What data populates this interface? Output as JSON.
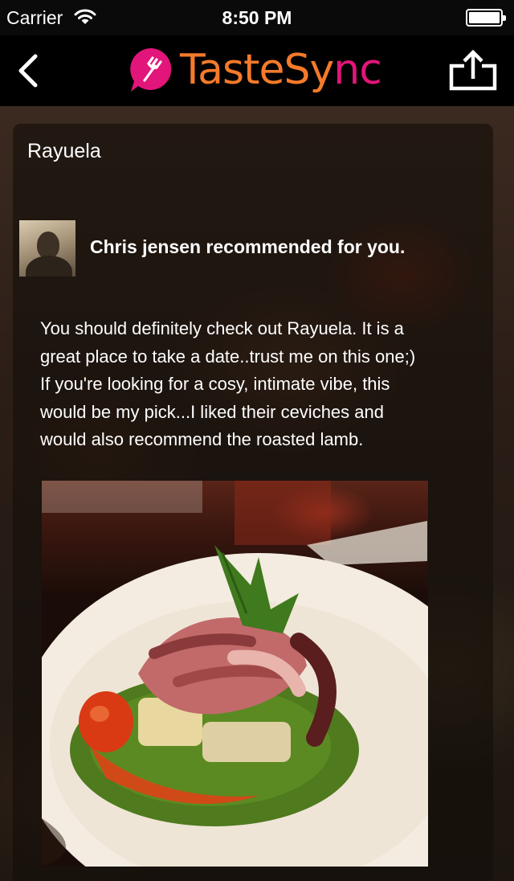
{
  "status_bar": {
    "carrier": "Carrier",
    "time": "8:50 PM"
  },
  "nav": {
    "logo_text_primary": "TasteSy",
    "logo_text_accent": "nc"
  },
  "card": {
    "place_name": "Rayuela",
    "recommendation": "Chris jensen recommended for you.",
    "review_lines": [
      "You should definitely check out Rayuela. It is a",
      "great place to take a date..trust me on this one;)",
      "If you're looking for a cosy, intimate vibe, this",
      "would be my pick...I liked their ceviches and",
      "would also recommend the roasted lamb."
    ]
  },
  "colors": {
    "logo_orange": "#f47a2a",
    "logo_pink": "#e2157a"
  },
  "icons": {
    "back": "chevron-left-icon",
    "share": "share-icon",
    "wifi": "wifi-icon",
    "battery": "battery-icon"
  }
}
